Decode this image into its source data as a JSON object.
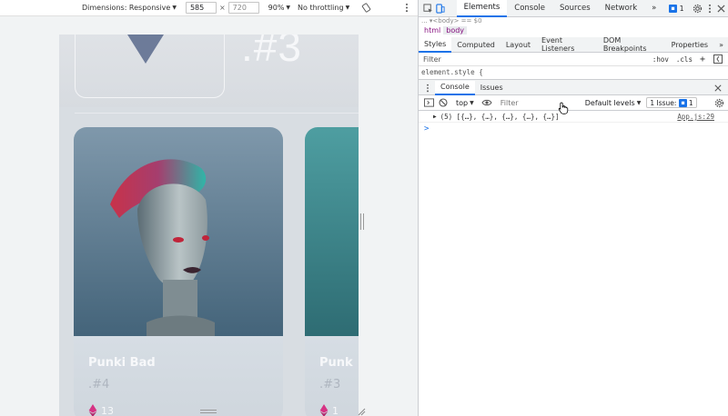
{
  "emulation_toolbar": {
    "dimensions_label": "Dimensions: Responsive",
    "width": "585",
    "times": "×",
    "height": "720",
    "zoom": "90%",
    "throttling": "No throttling"
  },
  "page": {
    "top_number": ".#3",
    "cards": [
      {
        "title": "Punki Bad",
        "number": ".#4",
        "price": "13"
      },
      {
        "title": "Punk",
        "number": ".#3",
        "price": "1"
      }
    ]
  },
  "devtools": {
    "tabs": [
      "Elements",
      "Console",
      "Sources",
      "Network"
    ],
    "active_tab": "Elements",
    "more": "»",
    "issues_count": "1",
    "crumb_partial": "... ▾<body> == $0",
    "crumbs": [
      "html",
      "body"
    ],
    "sub_tabs": [
      "Styles",
      "Computed",
      "Layout",
      "Event Listeners",
      "DOM Breakpoints",
      "Properties"
    ],
    "filter_placeholder": "Filter",
    "hov": ":hov",
    "cls": ".cls",
    "plus": "+",
    "element_style": "element.style {",
    "drawer_tabs": [
      "Console",
      "Issues"
    ],
    "console_toolbar": {
      "context": "top",
      "filter_placeholder": "Filter",
      "levels": "Default levels",
      "issues_label": "1 Issue:",
      "issues_count": "1"
    },
    "console_message": {
      "text": "(5) [{…}, {…}, {…}, {…}, {…}]",
      "source": "App.js:29"
    },
    "prompt": ">"
  },
  "colors": {
    "accent": "#1a73e8",
    "card_bg": "#d6dde4",
    "eth_pink": "#d63384"
  }
}
